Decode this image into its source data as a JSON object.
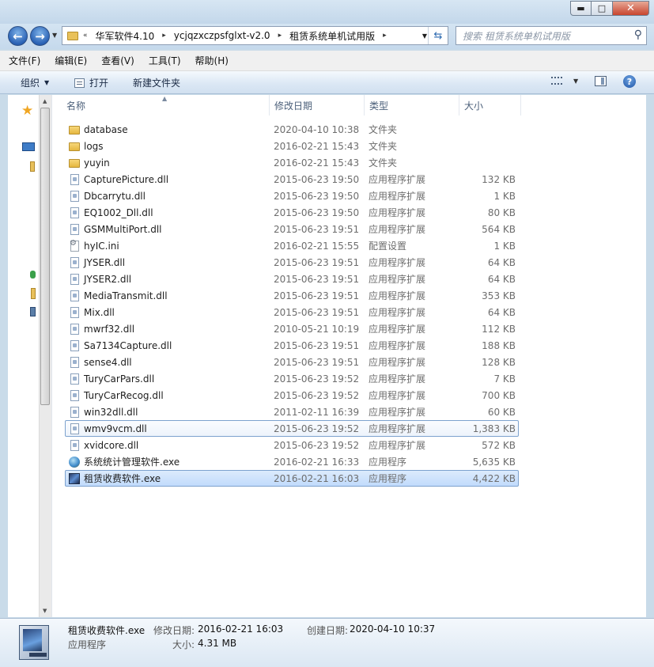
{
  "window": {
    "minimize_glyph": "▬",
    "maximize_glyph": "□",
    "close_glyph": "✕"
  },
  "address": {
    "overflow": "«",
    "crumbs": [
      "华军软件4.10",
      "ycjqzxczpsfglxt-v2.0",
      "租赁系统单机试用版"
    ]
  },
  "search": {
    "placeholder": "搜索 租赁系统单机试用版"
  },
  "menu": [
    "文件(F)",
    "编辑(E)",
    "查看(V)",
    "工具(T)",
    "帮助(H)"
  ],
  "commands": {
    "organize": "组织",
    "open": "打开",
    "new_folder": "新建文件夹",
    "help": "?"
  },
  "columns": {
    "name": "名称",
    "date": "修改日期",
    "type": "类型",
    "size": "大小"
  },
  "files": [
    {
      "name": "database",
      "date": "2020-04-10 10:38",
      "type": "文件夹",
      "size": "",
      "icon": "folder"
    },
    {
      "name": "logs",
      "date": "2016-02-21 15:43",
      "type": "文件夹",
      "size": "",
      "icon": "folder"
    },
    {
      "name": "yuyin",
      "date": "2016-02-21 15:43",
      "type": "文件夹",
      "size": "",
      "icon": "folder"
    },
    {
      "name": "CapturePicture.dll",
      "date": "2015-06-23 19:50",
      "type": "应用程序扩展",
      "size": "132 KB",
      "icon": "dll"
    },
    {
      "name": "Dbcarrytu.dll",
      "date": "2015-06-23 19:50",
      "type": "应用程序扩展",
      "size": "1 KB",
      "icon": "dll"
    },
    {
      "name": "EQ1002_Dll.dll",
      "date": "2015-06-23 19:50",
      "type": "应用程序扩展",
      "size": "80 KB",
      "icon": "dll"
    },
    {
      "name": "GSMMultiPort.dll",
      "date": "2015-06-23 19:51",
      "type": "应用程序扩展",
      "size": "564 KB",
      "icon": "dll"
    },
    {
      "name": "hyIC.ini",
      "date": "2016-02-21 15:55",
      "type": "配置设置",
      "size": "1 KB",
      "icon": "ini"
    },
    {
      "name": "JYSER.dll",
      "date": "2015-06-23 19:51",
      "type": "应用程序扩展",
      "size": "64 KB",
      "icon": "dll"
    },
    {
      "name": "JYSER2.dll",
      "date": "2015-06-23 19:51",
      "type": "应用程序扩展",
      "size": "64 KB",
      "icon": "dll"
    },
    {
      "name": "MediaTransmit.dll",
      "date": "2015-06-23 19:51",
      "type": "应用程序扩展",
      "size": "353 KB",
      "icon": "dll"
    },
    {
      "name": "Mix.dll",
      "date": "2015-06-23 19:51",
      "type": "应用程序扩展",
      "size": "64 KB",
      "icon": "dll"
    },
    {
      "name": "mwrf32.dll",
      "date": "2010-05-21 10:19",
      "type": "应用程序扩展",
      "size": "112 KB",
      "icon": "dll"
    },
    {
      "name": "Sa7134Capture.dll",
      "date": "2015-06-23 19:51",
      "type": "应用程序扩展",
      "size": "188 KB",
      "icon": "dll"
    },
    {
      "name": "sense4.dll",
      "date": "2015-06-23 19:51",
      "type": "应用程序扩展",
      "size": "128 KB",
      "icon": "dll"
    },
    {
      "name": "TuryCarPars.dll",
      "date": "2015-06-23 19:52",
      "type": "应用程序扩展",
      "size": "7 KB",
      "icon": "dll"
    },
    {
      "name": "TuryCarRecog.dll",
      "date": "2015-06-23 19:52",
      "type": "应用程序扩展",
      "size": "700 KB",
      "icon": "dll"
    },
    {
      "name": "win32dll.dll",
      "date": "2011-02-11 16:39",
      "type": "应用程序扩展",
      "size": "60 KB",
      "icon": "dll"
    },
    {
      "name": "wmv9vcm.dll",
      "date": "2015-06-23 19:52",
      "type": "应用程序扩展",
      "size": "1,383 KB",
      "icon": "dll",
      "state": "hover"
    },
    {
      "name": "xvidcore.dll",
      "date": "2015-06-23 19:52",
      "type": "应用程序扩展",
      "size": "572 KB",
      "icon": "dll"
    },
    {
      "name": "系统统计管理软件.exe",
      "date": "2016-02-21 16:33",
      "type": "应用程序",
      "size": "5,635 KB",
      "icon": "exe1"
    },
    {
      "name": "租赁收费软件.exe",
      "date": "2016-02-21 16:03",
      "type": "应用程序",
      "size": "4,422 KB",
      "icon": "exe2",
      "state": "selected"
    }
  ],
  "details": {
    "name": "租赁收费软件.exe",
    "kind": "应用程序",
    "modified_label": "修改日期:",
    "modified_value": "2016-02-21 16:03",
    "created_label": "创建日期:",
    "created_value": "2020-04-10 10:37",
    "size_label": "大小:",
    "size_value": "4.31 MB"
  },
  "colors": {
    "selection": "#c1dbfc",
    "selection_border": "#7da2ce",
    "chrome": "#c9dbe9"
  }
}
